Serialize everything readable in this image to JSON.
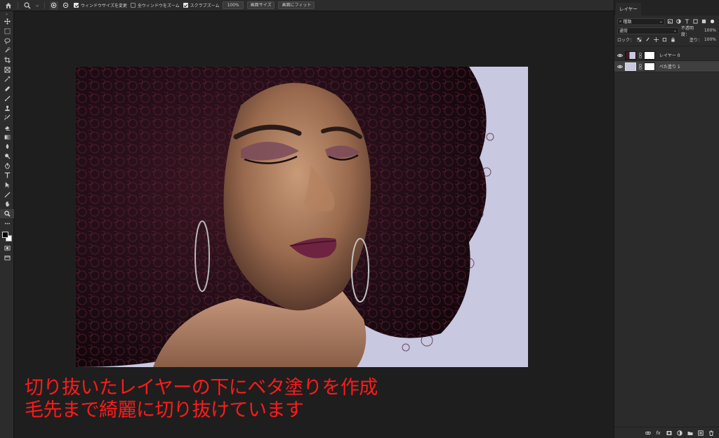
{
  "options_bar": {
    "resize_windows_label": "ウィンドウサイズを変更",
    "resize_windows_checked": true,
    "zoom_all_windows_label": "全ウィンドウをズーム",
    "zoom_all_windows_checked": false,
    "scrubby_zoom_label": "スクラブズーム",
    "scrubby_zoom_checked": true,
    "zoom_value": "100%",
    "fit_screen_label": "画面サイズ",
    "fill_screen_label": "画面にフィット"
  },
  "toolbar": {
    "tools": [
      "move-icon",
      "marquee-icon",
      "lasso-icon",
      "quick-select-icon",
      "crop-icon",
      "frame-icon",
      "eyedropper-icon",
      "healing-icon",
      "brush-icon",
      "stamp-icon",
      "history-brush-icon",
      "eraser-icon",
      "gradient-icon",
      "blur-icon",
      "dodge-icon",
      "pen-icon",
      "type-icon",
      "path-select-icon",
      "line-icon",
      "hand-icon",
      "zoom-icon",
      "more-icon"
    ]
  },
  "annotation": {
    "line1": "切り抜いたレイヤーの下にベタ塗りを作成",
    "line2": "毛先まで綺麗に切り抜けています",
    "color": "#ff1a1a"
  },
  "panel": {
    "tab_label": "レイヤー",
    "filter_kind": "種類",
    "blend_mode": "通常",
    "opacity_label": "不透明度：",
    "opacity_value": "100%",
    "lock_label": "ロック：",
    "fill_label": "塗り：",
    "fill_value": "100%",
    "layers": [
      {
        "name": "レイヤー 0",
        "selected": false
      },
      {
        "name": "べた塗り 1",
        "selected": true
      }
    ],
    "fill_color": "#c9c8e1"
  }
}
